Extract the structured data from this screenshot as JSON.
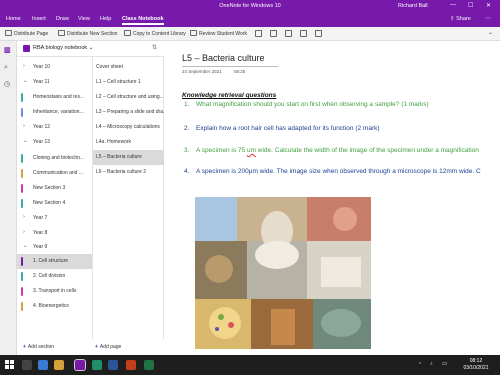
{
  "window": {
    "title": "OneNote for Windows 10",
    "user": "Richard Ball",
    "controls": [
      "—",
      "☐",
      "✕"
    ]
  },
  "menu": {
    "tabs": [
      "Home",
      "Insert",
      "Draw",
      "View",
      "Help",
      "Class Notebook"
    ],
    "active_tab": "Class Notebook",
    "share_label": "Share"
  },
  "ribbon": {
    "buttons": [
      "Distribute Page",
      "Distribute New Section",
      "Copy to Content Library",
      "Review Student Work"
    ]
  },
  "notebook": {
    "name": "RBA biology notebook",
    "sections": [
      {
        "label": "Year 10",
        "kind": "group"
      },
      {
        "label": "Year 11",
        "kind": "group"
      },
      {
        "label": "Homeostasis and res...",
        "kind": "section",
        "color": "#3aa9a9"
      },
      {
        "label": "Inheritance, variation...",
        "kind": "section",
        "color": "#6b8fd6"
      },
      {
        "label": "Year 12",
        "kind": "group"
      },
      {
        "label": "Year 13",
        "kind": "group"
      },
      {
        "label": "Cloning and biotechn...",
        "kind": "section",
        "color": "#3aa9a9"
      },
      {
        "label": "Communication and ...",
        "kind": "section",
        "color": "#d6a13a"
      },
      {
        "label": "New Section 3",
        "kind": "section",
        "color": "#d63aa9"
      },
      {
        "label": "New Section 4",
        "kind": "section",
        "color": "#3aa9a9"
      },
      {
        "label": "Year 7",
        "kind": "group"
      },
      {
        "label": "Year 8",
        "kind": "group"
      },
      {
        "label": "Year 9",
        "kind": "group"
      },
      {
        "label": "1. Cell structure",
        "kind": "section",
        "color": "#7719aa",
        "active": true
      },
      {
        "label": "2. Cell division",
        "kind": "section",
        "color": "#3aa9a9"
      },
      {
        "label": "3. Transport in cells",
        "kind": "section",
        "color": "#d63aa9"
      },
      {
        "label": "4. Bioenergetics",
        "kind": "section",
        "color": "#d6a13a"
      }
    ],
    "pages": [
      {
        "label": "Cover sheet"
      },
      {
        "label": "L1 – Cell structure 1"
      },
      {
        "label": "L2 – Cell structure and using..."
      },
      {
        "label": "L3 – Preparing a slide and dra..."
      },
      {
        "label": "L4 – Microscopy calculations"
      },
      {
        "label": "L4a. Homework"
      },
      {
        "label": "L5 – Bacteria culture",
        "active": true
      },
      {
        "label": "L6 – Bacteria culture 2"
      }
    ],
    "add_section_label": "Add section",
    "add_page_label": "Add page"
  },
  "page": {
    "title": "L5 – Bacteria culture",
    "date": "24 September 2021",
    "time": "08:25",
    "heading": "Knowledge retrieval questions",
    "questions": [
      {
        "num": "1.",
        "text": "What magnification should you start on first when observing a sample? (1 marks)",
        "color": "green"
      },
      {
        "num": "2.",
        "text": "Explain how a root hair cell has adapted for its function   (2 mark)",
        "color": "blue"
      },
      {
        "num": "3.",
        "text_before": "A specimen is 75 ",
        "unit": "um",
        "text_after": " wide. Calculate the width of the image of the specimen under a magnification",
        "color": "green"
      },
      {
        "num": "4.",
        "text": "A specimen is 200µm wide. The image size when observed through a microscope is 12mm wide. C",
        "color": "blue"
      }
    ]
  },
  "taskbar": {
    "time": "08:12",
    "date": "03/10/2021"
  },
  "colors": {
    "brand": "#7719aa",
    "question_green": "#3f9f3f",
    "question_blue": "#1f3f8f"
  }
}
